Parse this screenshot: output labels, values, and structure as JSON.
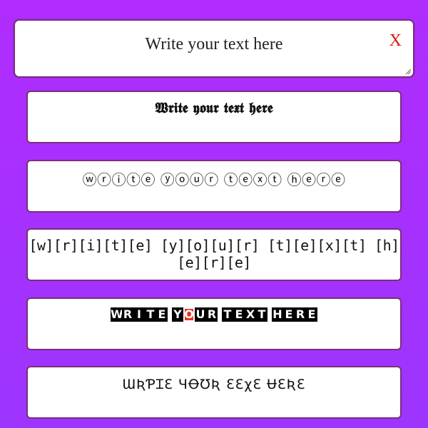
{
  "input": {
    "value": "Write your text here",
    "clear_label": "X"
  },
  "outputs": [
    {
      "style": "gothic",
      "text": "𝖂𝖗𝖎𝖙𝖊 𝖞𝖔𝖚𝖗 𝖙𝖊𝖝𝖙 𝖍𝖊𝖗𝖊"
    },
    {
      "style": "circled",
      "text": "ⓦⓡⓘⓣⓔ ⓨⓞⓤⓡ ⓣⓔⓧⓣ ⓗⓔⓡⓔ"
    },
    {
      "style": "bracketed",
      "text": "[w][r][i][t][e] [y][o][u][r] [t][e][x][t] [h][e][r][e]"
    },
    {
      "style": "tiles",
      "words": [
        [
          "W",
          "R",
          "I",
          "T",
          "E"
        ],
        [
          "Y",
          "O",
          "U",
          "R"
        ],
        [
          "T",
          "E",
          "X",
          "T"
        ],
        [
          "H",
          "E",
          "R",
          "E"
        ]
      ],
      "highlight_letter": "O"
    },
    {
      "style": "stylized",
      "text": "ƜƦƤꞮƐ ЧꝊƱƦ ƐƐχƐ ɄƐƦƐ"
    }
  ],
  "colors": {
    "background": "#a52eff",
    "box_border": "#7a2d7a",
    "clear": "#d61a1a",
    "tile_highlight": "#e8341e"
  }
}
